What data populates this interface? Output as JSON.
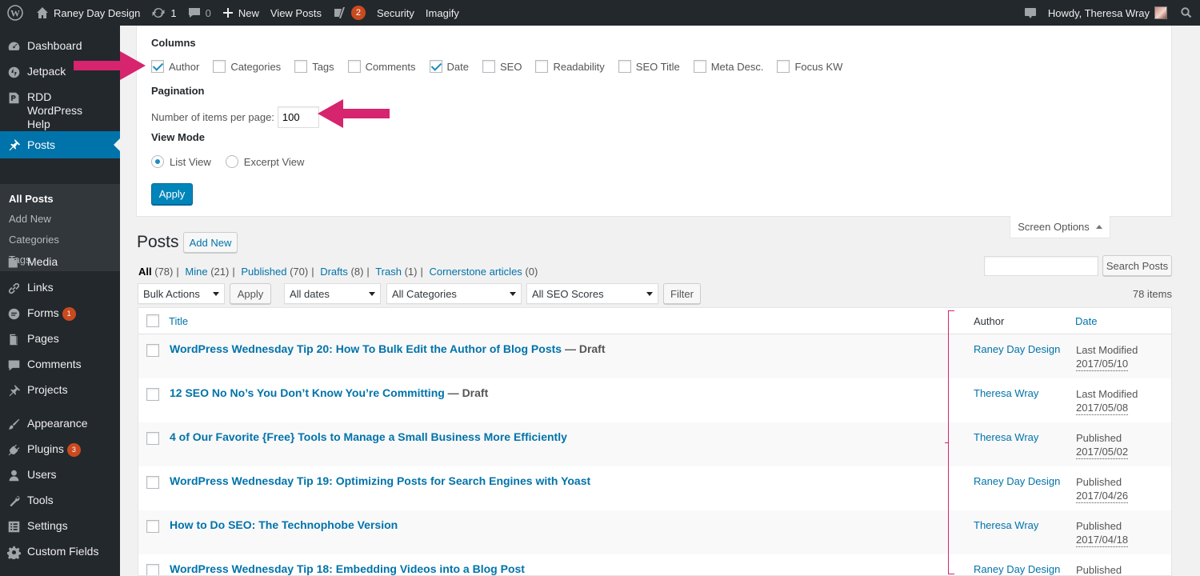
{
  "adminbar": {
    "site_name": "Raney Day Design",
    "updates_count": "1",
    "comments_count": "0",
    "new_label": "New",
    "view_posts_label": "View Posts",
    "yoast_count": "2",
    "security_label": "Security",
    "imagify_label": "Imagify",
    "howdy": "Howdy, Theresa Wray"
  },
  "sidebar": {
    "items": [
      {
        "label": "Dashboard",
        "icon": "dashboard-icon"
      },
      {
        "label": "Jetpack",
        "icon": "jetpack-icon"
      },
      {
        "label": "RDD WordPress Help",
        "icon": "help-icon"
      },
      {
        "label": "Posts",
        "icon": "pin-icon"
      },
      {
        "label": "Media",
        "icon": "media-icon"
      },
      {
        "label": "Links",
        "icon": "link-icon"
      },
      {
        "label": "Forms",
        "icon": "forms-icon",
        "badge": "1"
      },
      {
        "label": "Pages",
        "icon": "pages-icon"
      },
      {
        "label": "Comments",
        "icon": "comment-icon"
      },
      {
        "label": "Projects",
        "icon": "pin-icon"
      },
      {
        "label": "Appearance",
        "icon": "brush-icon"
      },
      {
        "label": "Plugins",
        "icon": "plugin-icon",
        "badge": "3"
      },
      {
        "label": "Users",
        "icon": "users-icon"
      },
      {
        "label": "Tools",
        "icon": "wrench-icon"
      },
      {
        "label": "Settings",
        "icon": "settings-icon"
      },
      {
        "label": "Custom Fields",
        "icon": "gear-icon"
      }
    ],
    "submenu": [
      "All Posts",
      "Add New",
      "Categories",
      "Tags"
    ]
  },
  "screen_options": {
    "columns_heading": "Columns",
    "columns": [
      {
        "label": "Author",
        "checked": true
      },
      {
        "label": "Categories",
        "checked": false
      },
      {
        "label": "Tags",
        "checked": false
      },
      {
        "label": "Comments",
        "checked": false
      },
      {
        "label": "Date",
        "checked": true
      },
      {
        "label": "SEO",
        "checked": false
      },
      {
        "label": "Readability",
        "checked": false
      },
      {
        "label": "SEO Title",
        "checked": false
      },
      {
        "label": "Meta Desc.",
        "checked": false
      },
      {
        "label": "Focus KW",
        "checked": false
      }
    ],
    "pagination_heading": "Pagination",
    "items_per_page_label": "Number of items per page:",
    "items_per_page_value": "100",
    "view_mode_heading": "View Mode",
    "list_view": "List View",
    "excerpt_view": "Excerpt View",
    "apply": "Apply",
    "tab_label": "Screen Options"
  },
  "posts": {
    "title": "Posts",
    "add_new": "Add New",
    "views": [
      {
        "label": "All",
        "count": "(78)",
        "current": true
      },
      {
        "label": "Mine",
        "count": "(21)"
      },
      {
        "label": "Published",
        "count": "(70)"
      },
      {
        "label": "Drafts",
        "count": "(8)"
      },
      {
        "label": "Trash",
        "count": "(1)"
      },
      {
        "label": "Cornerstone articles",
        "count": "(0)"
      }
    ],
    "search_button": "Search Posts",
    "bulk_actions": "Bulk Actions",
    "apply": "Apply",
    "all_dates": "All dates",
    "all_categories": "All Categories",
    "all_seo_scores": "All SEO Scores",
    "filter": "Filter",
    "items_count": "78 items",
    "col_title": "Title",
    "col_author": "Author",
    "col_date": "Date",
    "rows": [
      {
        "title": "WordPress Wednesday Tip 20: How To Bulk Edit the Author of Blog Posts",
        "state": " — Draft",
        "author": "Raney Day Design",
        "status": "Last Modified",
        "date": "2017/05/10"
      },
      {
        "title": "12 SEO No No’s You Don’t Know You’re Committing",
        "state": " — Draft",
        "author": "Theresa Wray",
        "status": "Last Modified",
        "date": "2017/05/08"
      },
      {
        "title": "4 of Our Favorite {Free} Tools to Manage a Small Business More Efficiently",
        "state": "",
        "author": "Theresa Wray",
        "status": "Published",
        "date": "2017/05/02"
      },
      {
        "title": "WordPress Wednesday Tip 19: Optimizing Posts for Search Engines with Yoast",
        "state": "",
        "author": "Raney Day Design",
        "status": "Published",
        "date": "2017/04/26"
      },
      {
        "title": "How to Do SEO: The Technophobe Version",
        "state": "",
        "author": "Theresa Wray",
        "status": "Published",
        "date": "2017/04/18"
      },
      {
        "title": "WordPress Wednesday Tip 18: Embedding Videos into a Blog Post",
        "state": "",
        "author": "Raney Day Design",
        "status": "Published",
        "date": ""
      }
    ]
  },
  "colors": {
    "accent": "#0073aa",
    "annotation": "#d6246e",
    "adminbar": "#23282d"
  }
}
